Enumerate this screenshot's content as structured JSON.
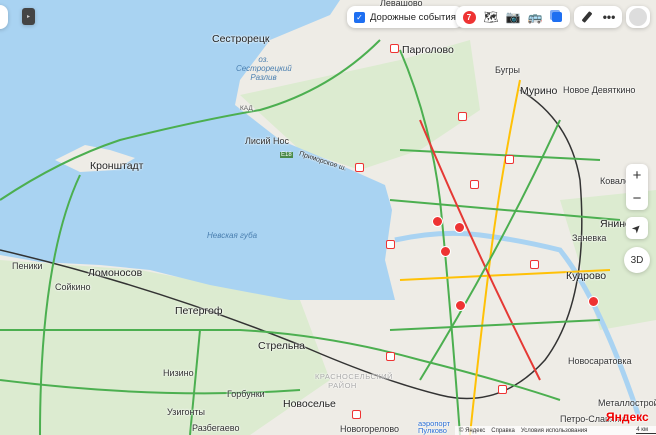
{
  "toolbar": {
    "traffic_events_label": "Дорожные события",
    "traffic_events_checked": true,
    "traffic_score": "7",
    "icons": [
      "traffic-score-icon",
      "panorama-icon",
      "camera-icon",
      "transit-icon",
      "layers-icon",
      "ruler-icon",
      "more-icon",
      "avatar-icon"
    ]
  },
  "controls": {
    "zoom_in": "+",
    "zoom_out": "−",
    "mode_3d": "3D",
    "icons": [
      "location-arrow-icon",
      "sidebar-toggle-icon"
    ]
  },
  "places": {
    "levashovo": "Левашово",
    "sestroretsk": "Сестрорецк",
    "razliv": "оз. Сестрорецкий Разлив",
    "pargolovo": "Парголово",
    "bugry": "Бугры",
    "murino": "Мурино",
    "devyatkino": "Новое Девяткино",
    "kronshtadt": "Кронштадт",
    "lisiy_nos": "Лисий Нос",
    "neva_bay": "Невская губа",
    "lomonosov": "Ломоносов",
    "peterhof": "Петергоф",
    "strelna": "Стрельна",
    "soykino": "Сойкино",
    "peniki": "Пеники",
    "nizino": "Низино",
    "gorbunki": "Горбунки",
    "uzigonty": "Узигонты",
    "razbegaevo": "Разбегаево",
    "novoselye": "Новоселье",
    "novogorelovo": "Новогорелово",
    "krasnoselsky": "КРАСНОСЕЛЬСКИЙ РАЙОН",
    "airport": "аэропорт Пулково",
    "kudrovo": "Кудрово",
    "zanevka": "Заневка",
    "yanino": "Янино",
    "kovalevo": "Ковалёво",
    "novosaratovka": "Новосаратовка",
    "petro_slavyanka": "Петро-Славянка",
    "metallostroy": "Металлострой",
    "primorskoe": "Приморское ш.",
    "kad": "КАД",
    "e18": "E18"
  },
  "footer": {
    "brand": "Яндекс",
    "copyright": "© Яндекс",
    "help": "Справка",
    "terms": "Условия использования",
    "scale": "4 км"
  }
}
